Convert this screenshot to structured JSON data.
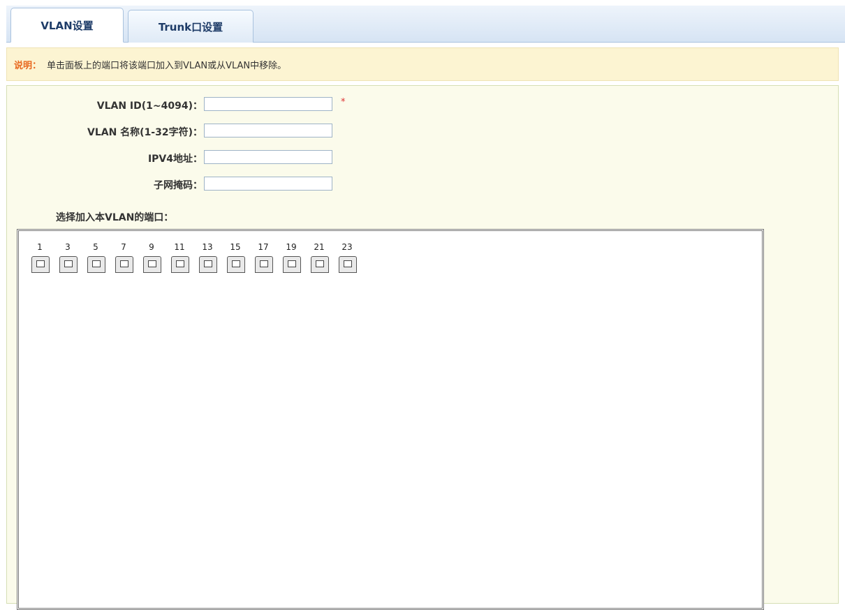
{
  "tabs": [
    {
      "label": "VLAN设置",
      "active": true
    },
    {
      "label": "Trunk口设置",
      "active": false
    }
  ],
  "note": {
    "label": "说明：",
    "text": "单击面板上的端口将该端口加入到VLAN或从VLAN中移除。"
  },
  "form": {
    "vlan_id": {
      "label": "VLAN ID(1~4094)：",
      "value": "",
      "required_mark": "*"
    },
    "vlan_name": {
      "label": "VLAN 名称(1-32字符)：",
      "value": ""
    },
    "ipv4": {
      "label": "IPV4地址：",
      "value": ""
    },
    "subnet": {
      "label": "子网掩码：",
      "value": ""
    }
  },
  "ports": {
    "title": "选择加入本VLAN的端口：",
    "top_numbers": [
      "1",
      "3",
      "5",
      "7",
      "9",
      "11",
      "13",
      "15",
      "17",
      "19",
      "21",
      "23"
    ]
  },
  "colors": {
    "accent": "#e8681e",
    "tab_text": "#1e3c68",
    "panel_bg": "#fbfbeb"
  }
}
